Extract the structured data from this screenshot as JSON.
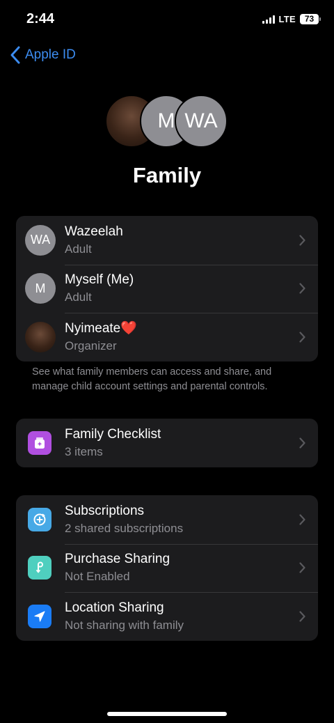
{
  "status": {
    "time": "2:44",
    "network": "LTE",
    "battery": "73"
  },
  "nav": {
    "back_label": "Apple ID"
  },
  "header": {
    "title": "Family",
    "avatars": [
      {
        "type": "photo",
        "initials": ""
      },
      {
        "type": "initials",
        "initials": "M"
      },
      {
        "type": "initials",
        "initials": "WA"
      }
    ]
  },
  "members": [
    {
      "initials": "WA",
      "name": "Wazeelah",
      "role": "Adult"
    },
    {
      "initials": "M",
      "name": "Myself (Me)",
      "role": "Adult"
    },
    {
      "initials": "",
      "name": "Nyimeate❤️",
      "role": "Organizer",
      "avatar": "photo"
    }
  ],
  "members_footnote": "See what family members can access and share, and manage child account settings and parental controls.",
  "checklist": {
    "title": "Family Checklist",
    "subtitle": "3 items",
    "icon": "checklist-icon",
    "color": "#b04fe0"
  },
  "services": [
    {
      "title": "Subscriptions",
      "subtitle": "2 shared subscriptions",
      "icon": "subscriptions-icon",
      "color": "#47a9e6"
    },
    {
      "title": "Purchase Sharing",
      "subtitle": "Not Enabled",
      "icon": "purchase-sharing-icon",
      "color": "#4fcfbf"
    },
    {
      "title": "Location Sharing",
      "subtitle": "Not sharing with family",
      "icon": "location-arrow-icon",
      "color": "#1a7cf5"
    }
  ]
}
